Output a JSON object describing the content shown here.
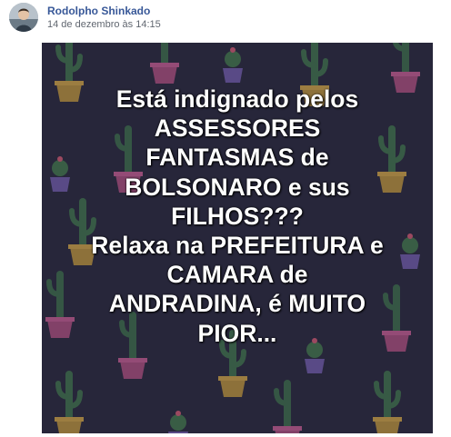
{
  "post": {
    "author": "Rodolpho Shinkado",
    "timestamp": "14 de dezembro às 14:15",
    "avatar_icon": "profile-avatar",
    "image": {
      "background_color": "#27263a",
      "pattern_icon": "cactus-pot-pattern",
      "text_lines": [
        "Está indignado pelos",
        "ASSESSORES",
        "FANTASMAS de",
        "BOLSONARO e sus",
        "FILHOS???",
        "Relaxa na PREFEITURA e",
        "CAMARA de",
        "ANDRADINA, é MUITO",
        "PIOR..."
      ]
    }
  }
}
